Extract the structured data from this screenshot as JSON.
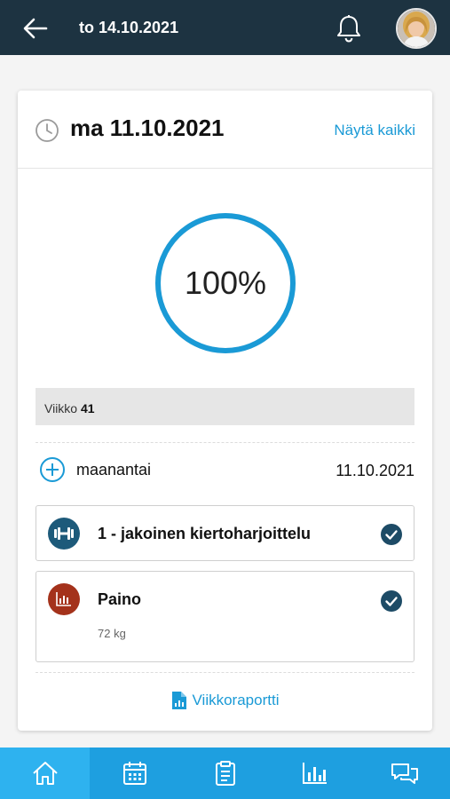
{
  "header": {
    "title": "to 14.10.2021",
    "back_icon": "arrow-left-icon",
    "notification_icon": "bell-icon",
    "avatar": "user-avatar"
  },
  "card": {
    "date": "ma 11.10.2021",
    "show_all_label": "Näytä kaikki",
    "progress_label": "100%",
    "progress_fraction": 1.0,
    "week_label": "Viikko",
    "week_number": "41",
    "day_name": "maanantai",
    "day_date": "11.10.2021",
    "items": [
      {
        "title": "1 - jakoinen kiertoharjoittelu",
        "icon": "dumbbell-icon",
        "icon_color": "#1d5a7a",
        "completed": true
      },
      {
        "title": "Paino",
        "subtitle": "72 kg",
        "icon": "bar-chart-icon",
        "icon_color": "#a4321b",
        "completed": true
      }
    ],
    "report_label": "Viikkoraportti",
    "report_icon": "report-file-icon"
  },
  "bottom_nav": [
    {
      "name": "home",
      "icon": "home-icon",
      "active": true
    },
    {
      "name": "calendar",
      "icon": "calendar-icon",
      "active": false
    },
    {
      "name": "tasks",
      "icon": "clipboard-icon",
      "active": false
    },
    {
      "name": "stats",
      "icon": "bar-chart-icon",
      "active": false
    },
    {
      "name": "messages",
      "icon": "chat-bubbles-icon",
      "active": false
    }
  ],
  "colors": {
    "topbar": "#1d3341",
    "accent": "#1a9ad6",
    "nav": "#1e9fe0",
    "nav_active": "#2eb2ef",
    "check": "#1d4b66"
  }
}
